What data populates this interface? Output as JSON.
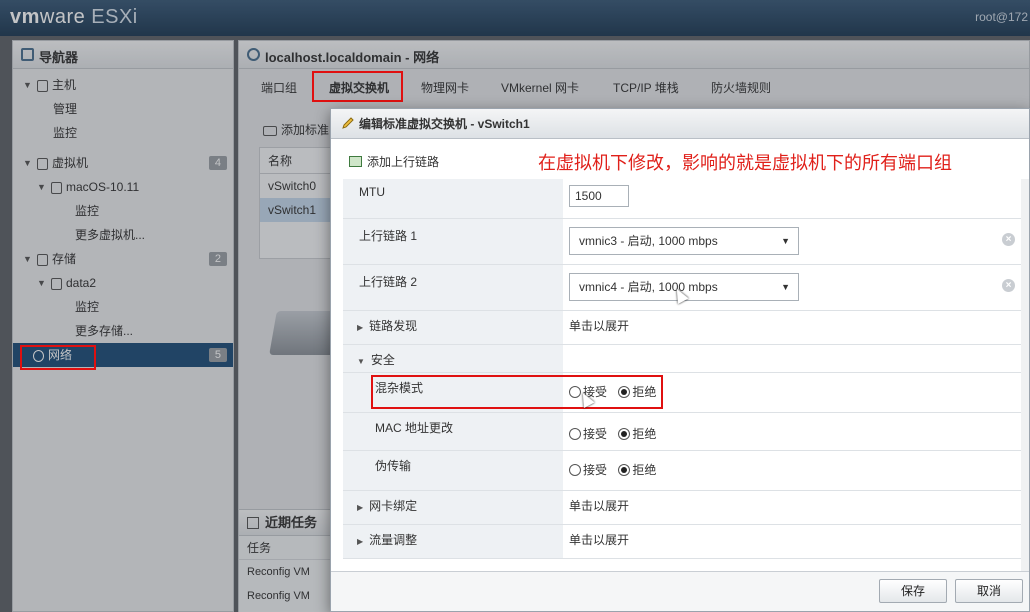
{
  "header": {
    "brand_vm": "vm",
    "brand_ware": "ware",
    "brand_product": "ESXi",
    "user": "root@172"
  },
  "navigator": {
    "title": "导航器",
    "items": [
      {
        "label": "主机"
      },
      {
        "label": "管理"
      },
      {
        "label": "监控"
      },
      {
        "label": "虚拟机",
        "count": "4"
      },
      {
        "label": "macOS-10.11"
      },
      {
        "label": "监控"
      },
      {
        "label": "更多虚拟机..."
      },
      {
        "label": "存储",
        "count": "2"
      },
      {
        "label": "data2"
      },
      {
        "label": "监控"
      },
      {
        "label": "更多存储..."
      },
      {
        "label": "网络",
        "count": "5"
      }
    ]
  },
  "content": {
    "title": "localhost.localdomain - 网络",
    "tabs": [
      "端口组",
      "虚拟交换机",
      "物理网卡",
      "VMkernel 网卡",
      "TCP/IP 堆栈",
      "防火墙规则"
    ],
    "toolbar_add": "添加标准",
    "table_header": "名称",
    "table_rows": [
      "vSwitch0",
      "vSwitch1"
    ],
    "tasks_title": "近期任务",
    "tasks_col": "任务",
    "tasks_rows": [
      "Reconfig VM",
      "Reconfig VM"
    ]
  },
  "dialog": {
    "title": "编辑标准虚拟交换机 - vSwitch1",
    "add_uplink": "添加上行链路",
    "annotation": "在虚拟机下修改，影响的就是虚拟机下的所有端口组",
    "mtu_label": "MTU",
    "mtu_value": "1500",
    "uplink1_label": "上行链路 1",
    "uplink1_value": "vmnic3 - 启动, 1000 mbps",
    "uplink2_label": "上行链路 2",
    "uplink2_value": "vmnic4 - 启动, 1000 mbps",
    "link_discovery_label": "链路发现",
    "expand_text": "单击以展开",
    "security_label": "安全",
    "promiscuous_label": "混杂模式",
    "mac_change_label": "MAC 地址更改",
    "forged_label": "伪传输",
    "accept": "接受",
    "reject": "拒绝",
    "nic_teaming_label": "网卡绑定",
    "traffic_shaping_label": "流量调整",
    "save": "保存",
    "cancel": "取消"
  },
  "colors": {
    "accent_red": "#e0201a",
    "nav_selected": "#1f4e79"
  }
}
